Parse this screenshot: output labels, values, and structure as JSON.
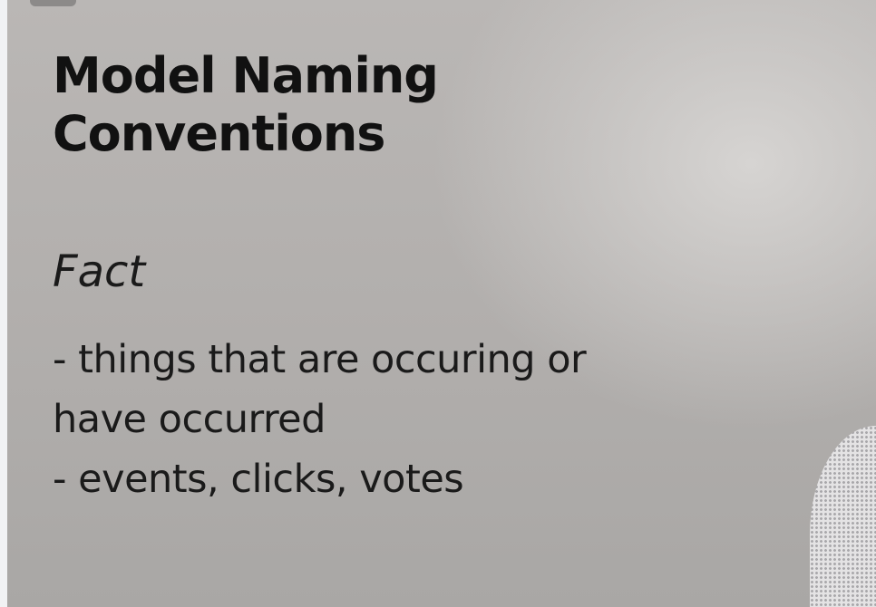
{
  "slide": {
    "title_line1": "Model Naming",
    "title_line2": "Conventions",
    "subtitle": "Fact",
    "lines": [
      "- things that are occuring or",
      "have occurred",
      "- events, clicks, votes"
    ]
  }
}
